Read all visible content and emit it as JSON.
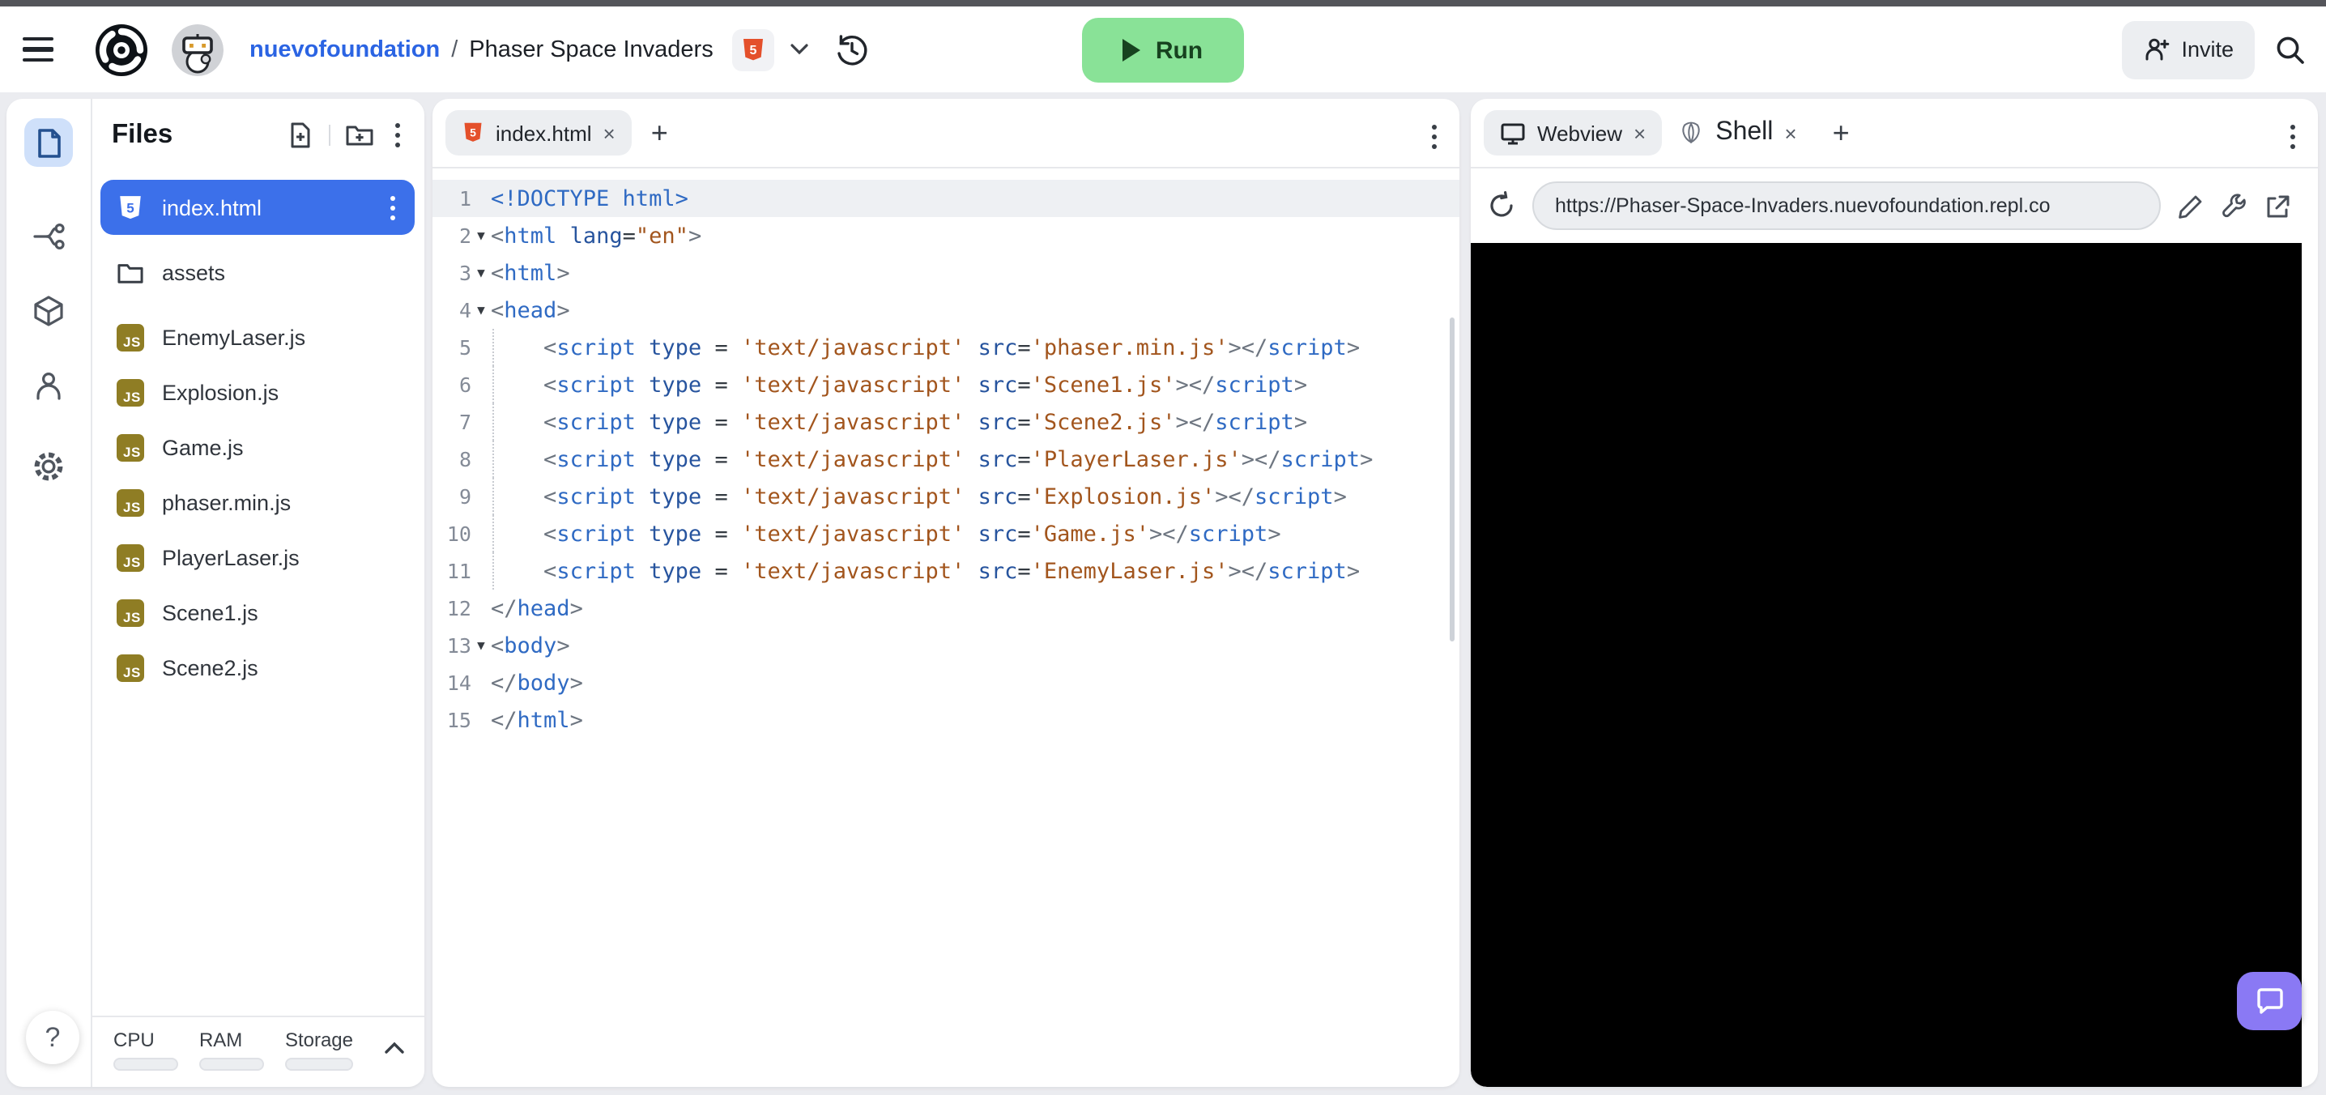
{
  "header": {
    "org": "nuevofoundation",
    "separator": "/",
    "project": "Phaser Space Invaders",
    "run_label": "Run",
    "invite_label": "Invite"
  },
  "colors": {
    "accent_blue": "#3c70ea",
    "run_green": "#89e297",
    "js_badge_olive": "#8f7d24",
    "html5_orange": "#e4502b",
    "chat_purple": "#8a79f4",
    "string_brown": "#a2551d",
    "tag_blue": "#2f6ac3"
  },
  "files_panel": {
    "title": "Files",
    "js_badge": "JS",
    "items": [
      {
        "label": "index.html",
        "icon": "html",
        "selected": true
      },
      {
        "label": "assets",
        "icon": "folder"
      },
      {
        "label": "EnemyLaser.js",
        "icon": "js"
      },
      {
        "label": "Explosion.js",
        "icon": "js"
      },
      {
        "label": "Game.js",
        "icon": "js"
      },
      {
        "label": "phaser.min.js",
        "icon": "js"
      },
      {
        "label": "PlayerLaser.js",
        "icon": "js"
      },
      {
        "label": "Scene1.js",
        "icon": "js"
      },
      {
        "label": "Scene2.js",
        "icon": "js"
      }
    ],
    "resources": {
      "cpu": "CPU",
      "ram": "RAM",
      "storage": "Storage"
    }
  },
  "editor": {
    "tab_label": "index.html",
    "lines": [
      {
        "n": "1",
        "active": true,
        "tokens": [
          [
            "t",
            "<!DOCTYPE html>"
          ]
        ]
      },
      {
        "n": "2",
        "fold": true,
        "tokens": [
          [
            "p",
            "<"
          ],
          [
            "t",
            "html"
          ],
          [
            "x",
            " "
          ],
          [
            "a",
            "lang"
          ],
          [
            "o",
            "="
          ],
          [
            "s",
            "\"en\""
          ],
          [
            "p",
            ">"
          ]
        ]
      },
      {
        "n": "3",
        "fold": true,
        "tokens": [
          [
            "p",
            "<"
          ],
          [
            "t",
            "html"
          ],
          [
            "p",
            ">"
          ]
        ]
      },
      {
        "n": "4",
        "fold": true,
        "tokens": [
          [
            "p",
            "<"
          ],
          [
            "t",
            "head"
          ],
          [
            "p",
            ">"
          ]
        ]
      },
      {
        "n": "5",
        "guide": true,
        "tokens": [
          [
            "x",
            "    "
          ],
          [
            "p",
            "<"
          ],
          [
            "t",
            "script"
          ],
          [
            "x",
            " "
          ],
          [
            "a",
            "type"
          ],
          [
            "o",
            " = "
          ],
          [
            "s",
            "'text/javascript'"
          ],
          [
            "x",
            " "
          ],
          [
            "a",
            "src"
          ],
          [
            "o",
            "="
          ],
          [
            "s",
            "'phaser.min.js'"
          ],
          [
            "p",
            "></"
          ],
          [
            "t",
            "script"
          ],
          [
            "p",
            ">"
          ]
        ]
      },
      {
        "n": "6",
        "guide": true,
        "tokens": [
          [
            "x",
            "    "
          ],
          [
            "p",
            "<"
          ],
          [
            "t",
            "script"
          ],
          [
            "x",
            " "
          ],
          [
            "a",
            "type"
          ],
          [
            "o",
            " = "
          ],
          [
            "s",
            "'text/javascript'"
          ],
          [
            "x",
            " "
          ],
          [
            "a",
            "src"
          ],
          [
            "o",
            "="
          ],
          [
            "s",
            "'Scene1.js'"
          ],
          [
            "p",
            "></"
          ],
          [
            "t",
            "script"
          ],
          [
            "p",
            ">"
          ]
        ]
      },
      {
        "n": "7",
        "guide": true,
        "tokens": [
          [
            "x",
            "    "
          ],
          [
            "p",
            "<"
          ],
          [
            "t",
            "script"
          ],
          [
            "x",
            " "
          ],
          [
            "a",
            "type"
          ],
          [
            "o",
            " = "
          ],
          [
            "s",
            "'text/javascript'"
          ],
          [
            "x",
            " "
          ],
          [
            "a",
            "src"
          ],
          [
            "o",
            "="
          ],
          [
            "s",
            "'Scene2.js'"
          ],
          [
            "p",
            "></"
          ],
          [
            "t",
            "script"
          ],
          [
            "p",
            ">"
          ]
        ]
      },
      {
        "n": "8",
        "guide": true,
        "tokens": [
          [
            "x",
            "    "
          ],
          [
            "p",
            "<"
          ],
          [
            "t",
            "script"
          ],
          [
            "x",
            " "
          ],
          [
            "a",
            "type"
          ],
          [
            "o",
            " = "
          ],
          [
            "s",
            "'text/javascript'"
          ],
          [
            "x",
            " "
          ],
          [
            "a",
            "src"
          ],
          [
            "o",
            "="
          ],
          [
            "s",
            "'PlayerLaser.js'"
          ],
          [
            "p",
            "></"
          ],
          [
            "t",
            "script"
          ],
          [
            "p",
            ">"
          ]
        ]
      },
      {
        "n": "9",
        "guide": true,
        "tokens": [
          [
            "x",
            "    "
          ],
          [
            "p",
            "<"
          ],
          [
            "t",
            "script"
          ],
          [
            "x",
            " "
          ],
          [
            "a",
            "type"
          ],
          [
            "o",
            " = "
          ],
          [
            "s",
            "'text/javascript'"
          ],
          [
            "x",
            " "
          ],
          [
            "a",
            "src"
          ],
          [
            "o",
            "="
          ],
          [
            "s",
            "'Explosion.js'"
          ],
          [
            "p",
            "></"
          ],
          [
            "t",
            "script"
          ],
          [
            "p",
            ">"
          ]
        ]
      },
      {
        "n": "10",
        "guide": true,
        "tokens": [
          [
            "x",
            "    "
          ],
          [
            "p",
            "<"
          ],
          [
            "t",
            "script"
          ],
          [
            "x",
            " "
          ],
          [
            "a",
            "type"
          ],
          [
            "o",
            " = "
          ],
          [
            "s",
            "'text/javascript'"
          ],
          [
            "x",
            " "
          ],
          [
            "a",
            "src"
          ],
          [
            "o",
            "="
          ],
          [
            "s",
            "'Game.js'"
          ],
          [
            "p",
            "></"
          ],
          [
            "t",
            "script"
          ],
          [
            "p",
            ">"
          ]
        ]
      },
      {
        "n": "11",
        "guide": true,
        "tokens": [
          [
            "x",
            "    "
          ],
          [
            "p",
            "<"
          ],
          [
            "t",
            "script"
          ],
          [
            "x",
            " "
          ],
          [
            "a",
            "type"
          ],
          [
            "o",
            " = "
          ],
          [
            "s",
            "'text/javascript'"
          ],
          [
            "x",
            " "
          ],
          [
            "a",
            "src"
          ],
          [
            "o",
            "="
          ],
          [
            "s",
            "'EnemyLaser.js'"
          ],
          [
            "p",
            "></"
          ],
          [
            "t",
            "script"
          ],
          [
            "p",
            ">"
          ]
        ]
      },
      {
        "n": "12",
        "tokens": [
          [
            "p",
            "</"
          ],
          [
            "t",
            "head"
          ],
          [
            "p",
            ">"
          ]
        ]
      },
      {
        "n": "13",
        "fold": true,
        "tokens": [
          [
            "p",
            "<"
          ],
          [
            "t",
            "body"
          ],
          [
            "p",
            ">"
          ]
        ]
      },
      {
        "n": "14",
        "tokens": [
          [
            "p",
            "</"
          ],
          [
            "t",
            "body"
          ],
          [
            "p",
            ">"
          ]
        ]
      },
      {
        "n": "15",
        "tokens": [
          [
            "p",
            "</"
          ],
          [
            "t",
            "html"
          ],
          [
            "p",
            ">"
          ]
        ]
      }
    ]
  },
  "webview": {
    "tabs": [
      {
        "label": "Webview",
        "active": true
      },
      {
        "label": "Shell",
        "active": false
      }
    ],
    "url": "https://Phaser-Space-Invaders.nuevofoundation.repl.co"
  }
}
